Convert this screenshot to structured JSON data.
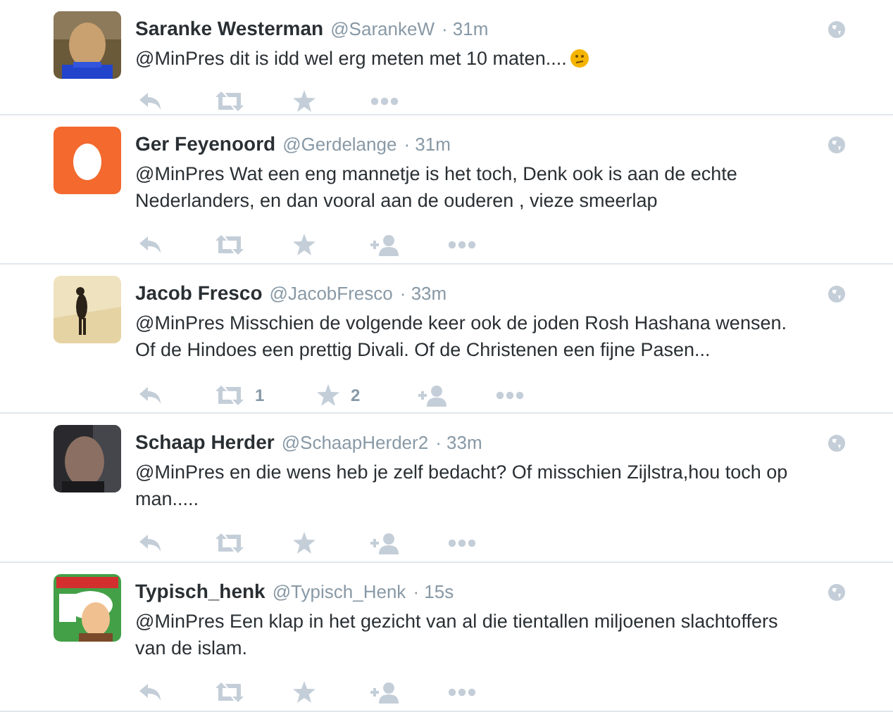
{
  "tweets": [
    {
      "avatar": {
        "kind": "picture"
      },
      "name": "Saranke Westerman",
      "handle": "@SarankeW",
      "time": "· 31m",
      "text": "@MinPres dit is idd wel erg meten met 10 maten....",
      "emoji": true,
      "actions": [
        {
          "kind": "reply"
        },
        {
          "kind": "retweet"
        },
        {
          "kind": "favorite"
        },
        {
          "kind": "more"
        }
      ]
    },
    {
      "avatar": {
        "kind": "egg"
      },
      "name": "Ger Feyenoord",
      "handle": "@Gerdelange",
      "time": "· 31m",
      "text": "@MinPres Wat een eng mannetje is het toch, Denk ook is aan de echte Nederlanders, en dan vooral aan de ouderen , vieze smeerlap",
      "actions": [
        {
          "kind": "reply"
        },
        {
          "kind": "retweet"
        },
        {
          "kind": "favorite"
        },
        {
          "kind": "follow"
        },
        {
          "kind": "more"
        }
      ]
    },
    {
      "avatar": {
        "kind": "picture"
      },
      "name": "Jacob Fresco",
      "handle": "@JacobFresco",
      "time": "· 33m",
      "text": "@MinPres Misschien de volgende keer ook de joden Rosh Hashana wensen. Of de Hindoes een prettig Divali. Of de Christenen een fijne Pasen...",
      "actions": [
        {
          "kind": "reply"
        },
        {
          "kind": "retweet",
          "count": "1"
        },
        {
          "kind": "favorite",
          "count": "2"
        },
        {
          "kind": "follow"
        },
        {
          "kind": "more"
        }
      ]
    },
    {
      "avatar": {
        "kind": "picture"
      },
      "name": "Schaap Herder",
      "handle": "@SchaapHerder2",
      "time": "· 33m",
      "text": "@MinPres en die wens heb je zelf bedacht? Of misschien Zijlstra,hou toch op man.....",
      "actions": [
        {
          "kind": "reply"
        },
        {
          "kind": "retweet"
        },
        {
          "kind": "favorite"
        },
        {
          "kind": "follow"
        },
        {
          "kind": "more"
        }
      ]
    },
    {
      "avatar": {
        "kind": "picture"
      },
      "name": "Typisch_henk",
      "handle": "@Typisch_Henk",
      "time": "· 15s",
      "text": "@MinPres Een klap in het gezicht van al die tientallen miljoenen slachtoffers van de islam.",
      "actions": [
        {
          "kind": "reply"
        },
        {
          "kind": "retweet"
        },
        {
          "kind": "favorite"
        },
        {
          "kind": "follow"
        },
        {
          "kind": "more"
        }
      ]
    }
  ]
}
